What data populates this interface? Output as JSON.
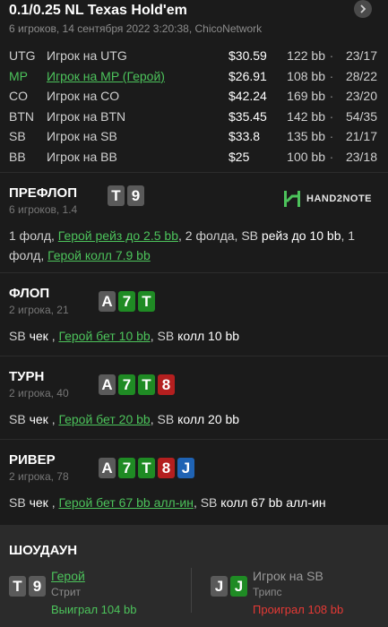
{
  "header": {
    "title": "0.1/0.25 NL Texas Hold'em",
    "subtitle": "6 игроков, 14 сентября 2022 3:20:38, ChicoNetwork",
    "close_icon": "chevron-right"
  },
  "players": [
    {
      "pos": "UTG",
      "name": "Игрок на UTG",
      "stack": "$30.59",
      "bb": "122 bb",
      "vpip": "23/17",
      "hero": false
    },
    {
      "pos": "MP",
      "name": "Игрок на MP (Герой)",
      "stack": "$26.91",
      "bb": "108 bb",
      "vpip": "28/22",
      "hero": true
    },
    {
      "pos": "CO",
      "name": "Игрок на CO",
      "stack": "$42.24",
      "bb": "169 bb",
      "vpip": "23/20",
      "hero": false
    },
    {
      "pos": "BTN",
      "name": "Игрок на BTN",
      "stack": "$35.45",
      "bb": "142 bb",
      "vpip": "54/35",
      "hero": false
    },
    {
      "pos": "SB",
      "name": "Игрок на SB",
      "stack": "$33.8",
      "bb": "135 bb",
      "vpip": "21/17",
      "hero": false
    },
    {
      "pos": "BB",
      "name": "Игрок на BB",
      "stack": "$25",
      "bb": "100 bb",
      "vpip": "23/18",
      "hero": false
    }
  ],
  "dot": "·",
  "logo": {
    "text": "HAND2NOTE"
  },
  "preflop": {
    "name": "ПРЕФЛОП",
    "sub": "6 игроков, 1.4",
    "cards": [
      "T",
      "9"
    ],
    "a1": "1 фолд,",
    "a2": "Герой рейз до 2.5 bb",
    "a3": ", 2 фолда, SB",
    "a4": "рейз до 10 bb",
    "a5": ", 1 фолд,",
    "a6": "Герой колл 7.9 bb"
  },
  "flop": {
    "name": "ФЛОП",
    "sub": "2 игрока, 21",
    "cards": [
      "A",
      "7",
      "T"
    ],
    "a1": "SB",
    "a2": "чек",
    "a3": ",",
    "a4": "Герой бет 10 bb",
    "a5": ", SB",
    "a6": "колл 10 bb"
  },
  "turn": {
    "name": "ТУРН",
    "sub": "2 игрока, 40",
    "cards": [
      "A",
      "7",
      "T",
      "8"
    ],
    "a1": "SB",
    "a2": "чек",
    "a3": ",",
    "a4": "Герой бет 20 bb",
    "a5": ", SB",
    "a6": "колл 20 bb"
  },
  "river": {
    "name": "РИВЕР",
    "sub": "2 игрока, 78",
    "cards": [
      "A",
      "7",
      "T",
      "8",
      "J"
    ],
    "a1": "SB",
    "a2": "чек",
    "a3": ",",
    "a4": "Герой бет 67 bb алл-ин",
    "a5": ", SB",
    "a6": "колл 67 bb алл-ин"
  },
  "showdown": {
    "title": "ШОУДАУН",
    "hero": {
      "cards": [
        "T",
        "9"
      ],
      "name": "Герой",
      "hand": "Стрит",
      "result": "Выиграл 104 bb",
      "result_color": "#4cc35b"
    },
    "villain": {
      "cards": [
        "J",
        "J"
      ],
      "name": "Игрок на SB",
      "hand": "Трипс",
      "result": "Проиграл 108 bb",
      "result_color": "#e53935"
    }
  },
  "colors": {
    "hero": "#4cc35b",
    "win": "#4cc35b",
    "loss": "#e53935"
  }
}
